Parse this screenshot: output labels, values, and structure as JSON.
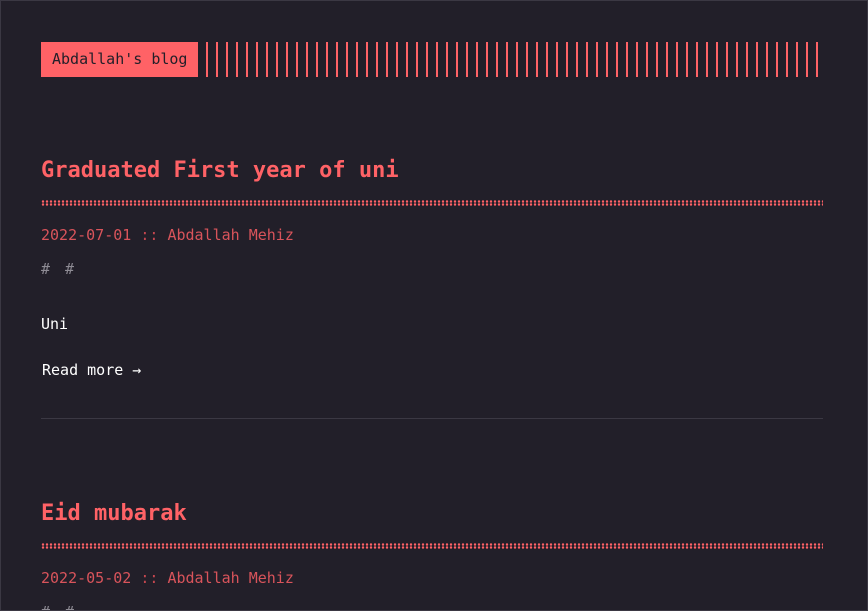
{
  "site": {
    "logo_text": "Abdallah's blog"
  },
  "posts": [
    {
      "title": "Graduated First year of uni",
      "date": "2022-07-01",
      "separator": "::",
      "author": "Abdallah Mehiz",
      "tags": "# #",
      "summary": "Uni",
      "read_more": "Read more →"
    },
    {
      "title": "Eid mubarak",
      "date": "2022-05-02",
      "separator": "::",
      "author": "Abdallah Mehiz",
      "tags": "# #"
    }
  ],
  "colors": {
    "background": "#221f29",
    "accent": "#ff6266",
    "text": "#ffffff",
    "muted": "#8e8b94"
  }
}
